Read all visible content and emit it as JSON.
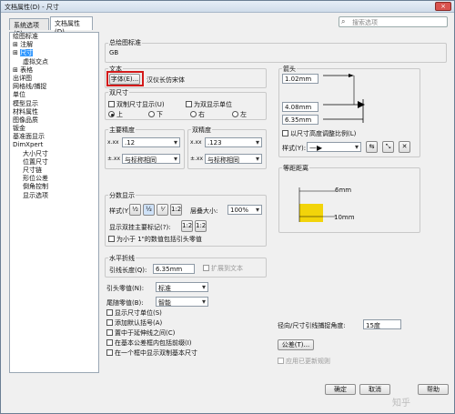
{
  "window": {
    "title": "文档属性(D) - 尺寸"
  },
  "tabs": [
    {
      "label": "系统选项(S)"
    },
    {
      "label": "文档属性(D)"
    }
  ],
  "search": {
    "placeholder": "搜索选项"
  },
  "tree": [
    "绘图标准",
    "注解",
    "尺寸",
    "虚拟交点",
    "表格",
    "出详图",
    "网格线/捕捉",
    "单位",
    "模型显示",
    "材料属性",
    "图像品质",
    "钣金",
    "基准面显示",
    "DimXpert",
    "大小尺寸",
    "位置尺寸",
    "尺寸链",
    "形位公差",
    "倒角控制",
    "显示选项"
  ],
  "overall_standard": {
    "label": "总绘图标准",
    "value": "GB"
  },
  "text": {
    "label": "文本",
    "font_button": "字体(E)...",
    "font_name": "汉仪长仿宋体"
  },
  "dual": {
    "label": "双尺寸",
    "show_dual": "双制尺寸显示(U)",
    "show_units": "为双显示单位",
    "positions": [
      "上",
      "下",
      "右",
      "左"
    ]
  },
  "primary": {
    "label": "主要精度",
    "value1": ".12",
    "value2": "与标称相同"
  },
  "secondary": {
    "label": "双精度",
    "value1": ".123",
    "value2": "与标称相同"
  },
  "arrows": {
    "label": "箭头",
    "d1": "1.02mm",
    "d2": "4.08mm",
    "d3": "6.35mm",
    "scale_check": "以尺寸高度调整比例(L)",
    "style_label": "样式(Y):"
  },
  "fraction": {
    "label": "分数显示",
    "style_label": "样式(Y):",
    "stack_label": "层叠大小:",
    "stack_value": "100%",
    "leading_label": "显示双挂主要标记(?):",
    "less_than_one": "为小于 1\"的数值包括引头零值"
  },
  "equal": {
    "label": "等距距离",
    "v1": "6mm",
    "v2": "10mm"
  },
  "horizontal": {
    "label": "水平折线",
    "leader_length_label": "引线长度(Q):",
    "leader_length_value": "6.35mm",
    "extend_text": "扩展到文本"
  },
  "leading_zero": {
    "label": "引头零值(N):",
    "value": "标准"
  },
  "trailing_zero": {
    "label": "尾随零值(B):",
    "value": "智能"
  },
  "options": [
    "显示尺寸单位(S)",
    "添加默认括号(A)",
    "置中于延伸线之间(C)",
    "在基本公差框内包括前缀(I)",
    "在一个框中显示双制基本尺寸"
  ],
  "radial": {
    "label": "径向/尺寸引线捕捉角度:",
    "value": "15度"
  },
  "tolerance_button": "公差(T)...",
  "apply_update": "应用已更新规则",
  "buttons": {
    "ok": "确定",
    "cancel": "取消",
    "help": "帮助"
  },
  "watermark": "知乎"
}
